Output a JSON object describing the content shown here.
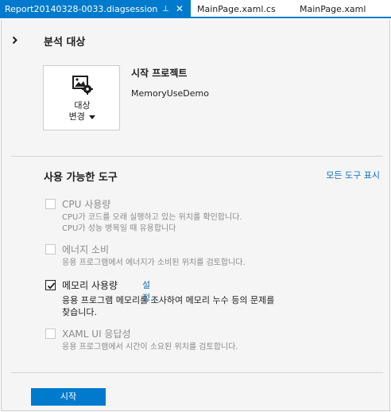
{
  "tabs": [
    {
      "label": "Report20140328-0033.diagsession",
      "active": true
    },
    {
      "label": "MainPage.xaml.cs",
      "active": false
    },
    {
      "label": "MainPage.xaml",
      "active": false
    }
  ],
  "tab_icons": {
    "pin": "⊥",
    "close": "✕"
  },
  "target_section": {
    "title": "분석 대상",
    "change_target_label_line1": "대상",
    "change_target_label_line2": "변경",
    "startup_project_title": "시작 프로젝트",
    "startup_project_value": "MemoryUseDemo"
  },
  "tools_section": {
    "title": "사용 가능한 도구",
    "show_all_link": "모든 도구 표시",
    "tools": [
      {
        "name": "CPU 사용량",
        "checked": false,
        "enabled": false,
        "desc_line1": "CPU가 코드를 오래 실행하고 있는 위치를 확인합니다.",
        "desc_line2": "CPU가 성능 병목일 때 유용합니다"
      },
      {
        "name": "에너지 소비",
        "checked": false,
        "enabled": false,
        "desc_line1": "응용 프로그램에서 에너지가 소비된 위치를 검토합니다."
      },
      {
        "name": "메모리 사용량",
        "checked": true,
        "enabled": true,
        "settings_link": "설정...",
        "desc_line1": "응용 프로그램 메모리를 조사하여 메모리 누수 등의 문제를",
        "desc_line2": "찾습니다."
      },
      {
        "name": "XAML UI 응답성",
        "checked": false,
        "enabled": false,
        "desc_line1": "응용 프로그램에서 시간이 소요된 위치를 검토합니다."
      }
    ]
  },
  "start_button_label": "시작",
  "colors": {
    "accent": "#007acc",
    "link": "#0e70c0",
    "disabled_text": "#8a8a8a"
  }
}
